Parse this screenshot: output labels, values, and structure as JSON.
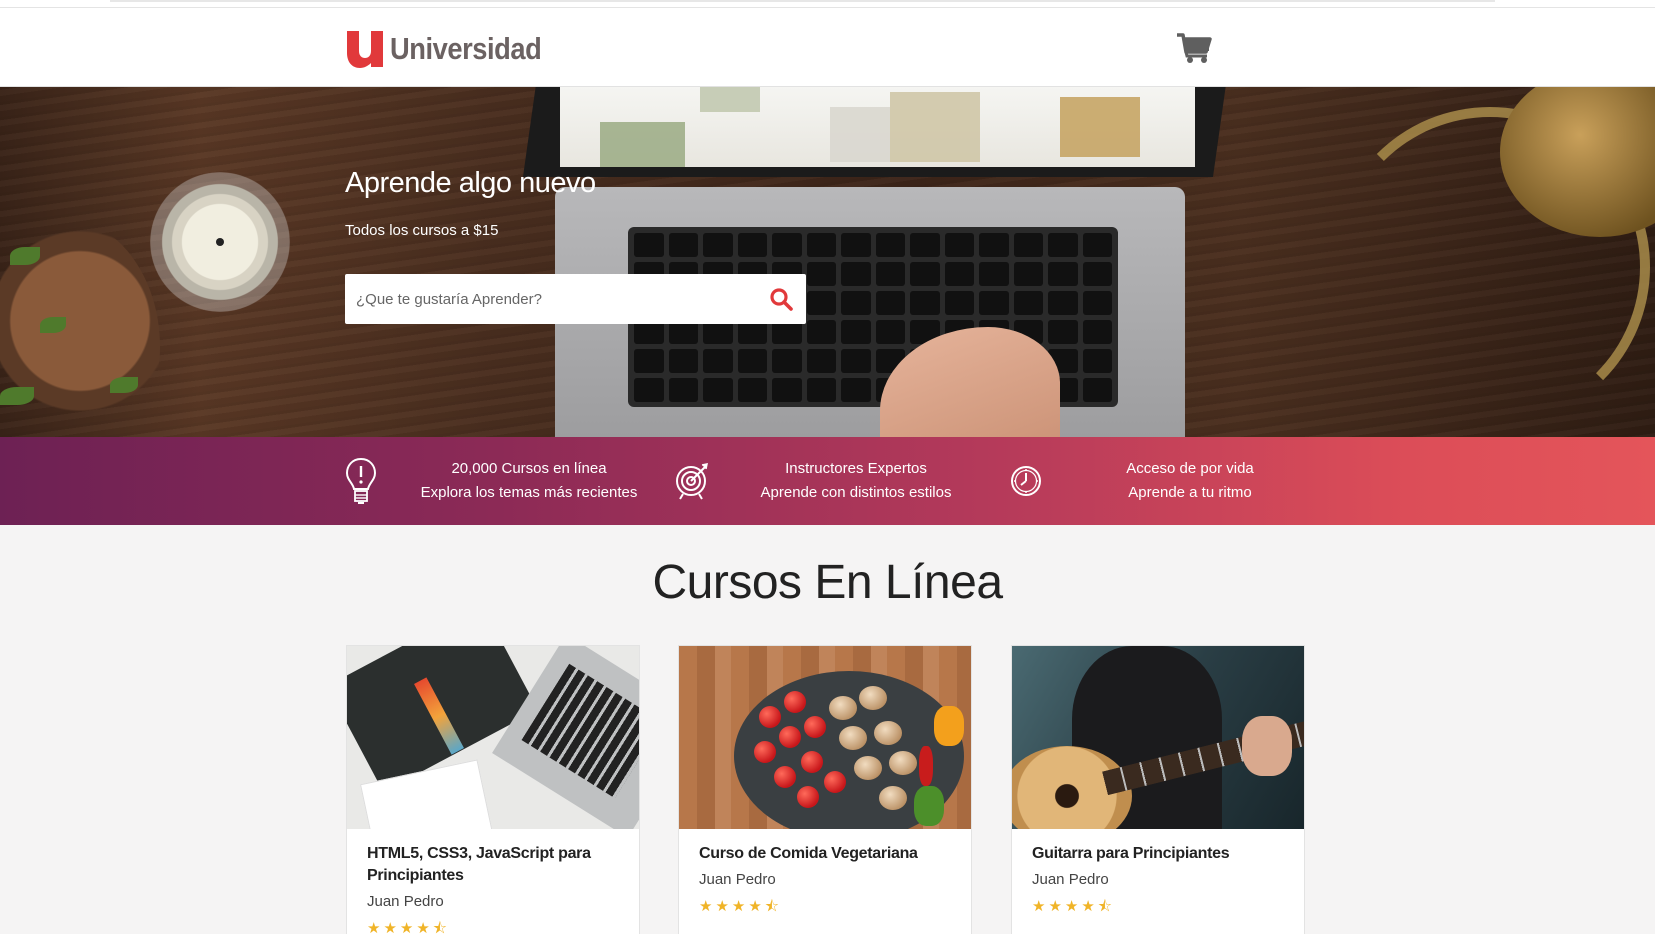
{
  "brand": {
    "logo_letter": "u",
    "name": "Universidad",
    "accent_color": "#e1393b"
  },
  "header": {
    "cart_icon": "cart-icon"
  },
  "hero": {
    "title": "Aprende algo nuevo",
    "subtitle": "Todos los cursos a $15",
    "search_placeholder": "¿Que te gustaría Aprender?",
    "search_icon": "search-icon"
  },
  "features": [
    {
      "icon": "lightbulb-icon",
      "line1": "20,000 Cursos en línea",
      "line2": "Explora los temas más recientes"
    },
    {
      "icon": "target-icon",
      "line1": "Instructores Expertos",
      "line2": "Aprende con distintos estilos"
    },
    {
      "icon": "clock-icon",
      "line1": "Acceso de por vida",
      "line2": "Aprende a tu ritmo"
    }
  ],
  "section": {
    "title": "Cursos En Línea"
  },
  "courses": [
    {
      "title": "HTML5, CSS3, JavaScript para Principiantes",
      "author": "Juan Pedro",
      "rating": 4.5,
      "stars": "★★★★⯪"
    },
    {
      "title": "Curso de Comida Vegetariana",
      "author": "Juan Pedro",
      "rating": 4.5,
      "stars": "★★★★⯪"
    },
    {
      "title": "Guitarra para Principiantes",
      "author": "Juan Pedro",
      "rating": 4.5,
      "stars": "★★★★⯪"
    }
  ],
  "colors": {
    "feature_gradient_start": "#6d2154",
    "feature_gradient_end": "#e4555a",
    "star_color": "#f0b428"
  }
}
